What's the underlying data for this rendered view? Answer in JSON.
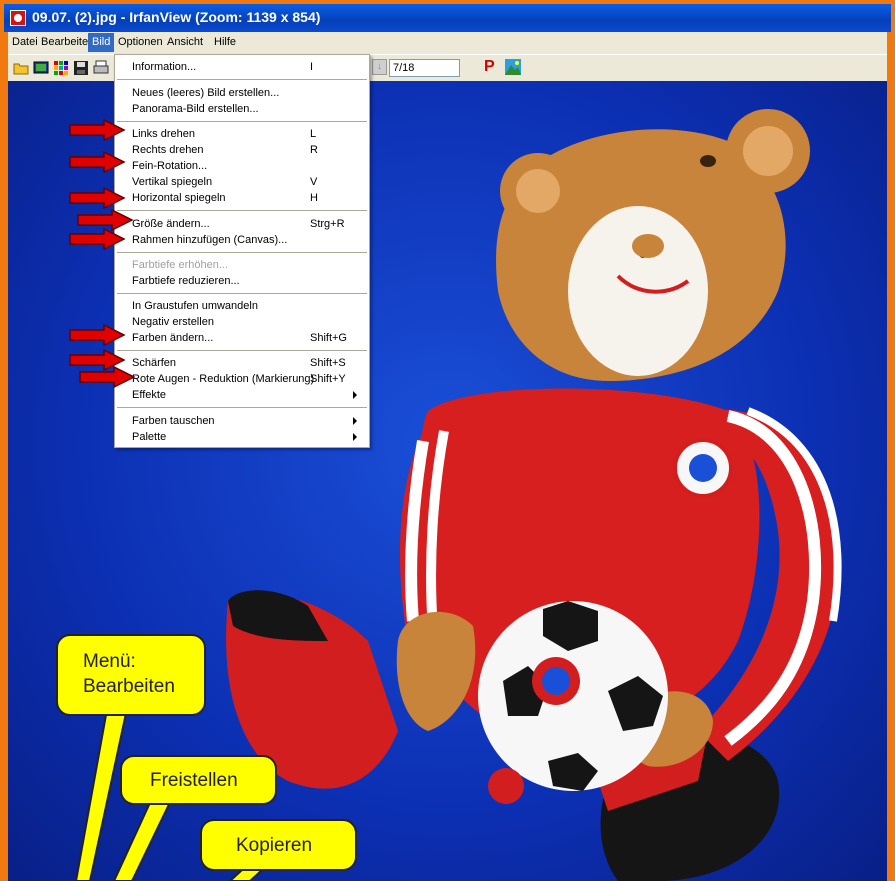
{
  "window": {
    "title": "09.07. (2).jpg - IrfanView (Zoom: 1139 x 854)"
  },
  "menubar": {
    "items": [
      "Datei",
      "Bearbeiten",
      "Bild",
      "Optionen",
      "Ansicht",
      "Hilfe"
    ],
    "active": "Bild"
  },
  "toolbar": {
    "page_indicator": "7/18",
    "p_label": "P"
  },
  "bild_menu": {
    "items": [
      {
        "label": "Information...",
        "shortcut": "I"
      },
      {
        "label": "Neues (leeres) Bild erstellen...",
        "shortcut": ""
      },
      {
        "label": "Panorama-Bild erstellen...",
        "shortcut": ""
      },
      {
        "label": "Links drehen",
        "shortcut": "L"
      },
      {
        "label": "Rechts drehen",
        "shortcut": "R"
      },
      {
        "label": "Fein-Rotation...",
        "shortcut": ""
      },
      {
        "label": "Vertikal spiegeln",
        "shortcut": "V"
      },
      {
        "label": "Horizontal spiegeln",
        "shortcut": "H"
      },
      {
        "label": "Größe ändern...",
        "shortcut": "Strg+R"
      },
      {
        "label": "Rahmen hinzufügen (Canvas)...",
        "shortcut": ""
      },
      {
        "label": "Farbtiefe erhöhen...",
        "shortcut": "",
        "disabled": true
      },
      {
        "label": "Farbtiefe reduzieren...",
        "shortcut": ""
      },
      {
        "label": "In Graustufen umwandeln",
        "shortcut": ""
      },
      {
        "label": "Negativ erstellen",
        "shortcut": ""
      },
      {
        "label": "Farben ändern...",
        "shortcut": "Shift+G"
      },
      {
        "label": "Schärfen",
        "shortcut": "Shift+S"
      },
      {
        "label": "Rote Augen - Reduktion (Markierung)",
        "shortcut": "Shift+Y"
      },
      {
        "label": "Effekte",
        "shortcut": "",
        "submenu": true
      },
      {
        "label": "Farben tauschen",
        "shortcut": "",
        "submenu": true
      },
      {
        "label": "Palette",
        "shortcut": "",
        "submenu": true
      }
    ]
  },
  "callouts": {
    "bearbeiten_line1": "Menü:",
    "bearbeiten_line2": "Bearbeiten",
    "freistellen": "Freistellen",
    "kopieren": "Kopieren"
  },
  "colors": {
    "accent": "#316ac5",
    "window_frame": "#f07a10",
    "background": "#0c2fb2",
    "callout": "#ffff00",
    "arrow": "#e00000"
  }
}
